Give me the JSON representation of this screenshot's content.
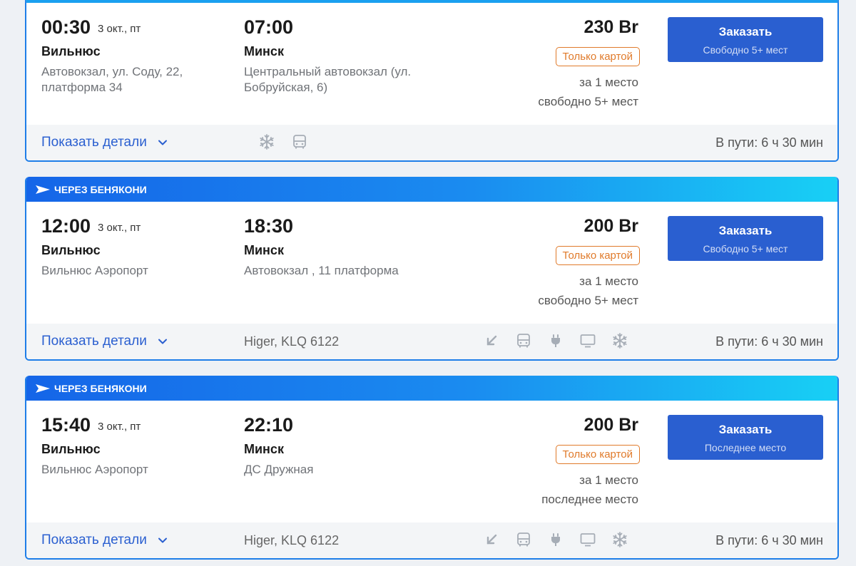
{
  "banner_text": "ЧЕРЕЗ БЕНЯКОНИ",
  "trips": [
    {
      "dep_time": "00:30",
      "dep_date": "3 окт., пт",
      "dep_city": "Вильнюс",
      "dep_addr": "Автовокзал, ул. Соду, 22, платформа 34",
      "arr_time": "07:00",
      "arr_city": "Минск",
      "arr_addr": "Центральный автовокзал (ул. Бобруйская, 6)",
      "price": "230 Br",
      "payment": "Только картой",
      "per_seat": "за 1 место",
      "seats": "свободно 5+ мест",
      "order_label": "Заказать",
      "order_sub": "Свободно 5+ мест",
      "details": "Показать детали",
      "bus_model": "",
      "duration": "В пути: 6 ч 30 мин",
      "amenities": [
        "snowflake-icon",
        "bus-icon"
      ]
    },
    {
      "dep_time": "12:00",
      "dep_date": "3 окт., пт",
      "dep_city": "Вильнюс",
      "dep_addr": "Вильнюс Аэропорт",
      "arr_time": "18:30",
      "arr_city": "Минск",
      "arr_addr": "Автовокзал , 11 платформа",
      "price": "200 Br",
      "payment": "Только картой",
      "per_seat": "за 1 место",
      "seats": "свободно 5+ мест",
      "order_label": "Заказать",
      "order_sub": "Свободно 5+ мест",
      "details": "Показать детали",
      "bus_model": "Higer, KLQ 6122",
      "duration": "В пути: 6 ч 30 мин",
      "amenities": [
        "recline-seat-icon",
        "bus-icon",
        "power-plug-icon",
        "tv-icon",
        "snowflake-icon"
      ]
    },
    {
      "dep_time": "15:40",
      "dep_date": "3 окт., пт",
      "dep_city": "Вильнюс",
      "dep_addr": "Вильнюс Аэропорт",
      "arr_time": "22:10",
      "arr_city": "Минск",
      "arr_addr": "ДС Дружная",
      "price": "200 Br",
      "payment": "Только картой",
      "per_seat": "за 1 место",
      "seats": "последнее место",
      "order_label": "Заказать",
      "order_sub": "Последнее место",
      "details": "Показать детали",
      "bus_model": "Higer, KLQ 6122",
      "duration": "В пути: 6 ч 30 мин",
      "amenities": [
        "recline-seat-icon",
        "bus-icon",
        "power-plug-icon",
        "tv-icon",
        "snowflake-icon"
      ]
    }
  ],
  "colors": {
    "accent": "#2a5fd0",
    "card_border": "#1e7ee8",
    "payment_badge": "#e07a2a",
    "banner_start": "#1565e8",
    "banner_end": "#18d0f5",
    "icon": "#a6adb6"
  }
}
